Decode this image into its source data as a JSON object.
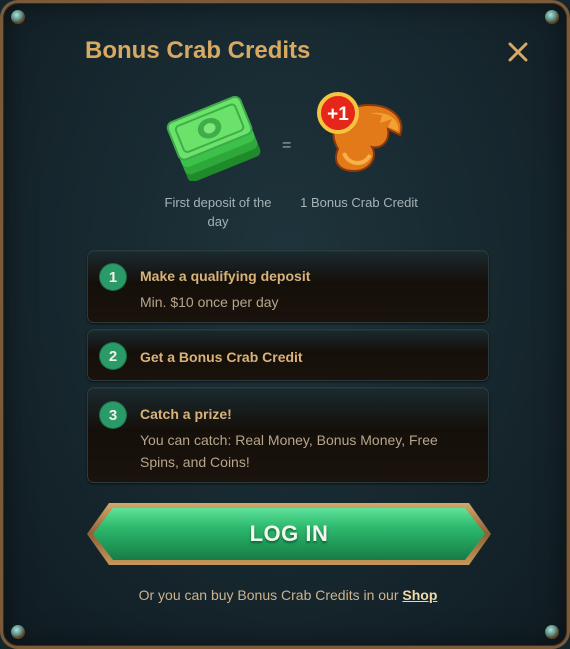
{
  "modal": {
    "title": "Bonus Crab Credits",
    "close_icon": "close-icon",
    "colors": {
      "title": "#d7a963",
      "accent_green": "#2fbb6f",
      "step_number_bg": "#2a9a68",
      "frame_gold": "#b58a52"
    }
  },
  "exchange": {
    "left_caption": "First deposit of the day",
    "equals": "=",
    "right_caption": "1 Bonus Crab Credit",
    "badge": "+1",
    "left_icon": "money-stack-icon",
    "right_icon": "crab-claw-icon"
  },
  "steps": [
    {
      "number": "1",
      "title": "Make a qualifying deposit",
      "description": "Min. $10 once per day"
    },
    {
      "number": "2",
      "title": "Get a Bonus Crab Credit",
      "description": ""
    },
    {
      "number": "3",
      "title": "Catch a prize!",
      "description": "You can catch: Real Money, Bonus Money, Free Spins, and Coins!"
    }
  ],
  "login_button": {
    "label": "LOG IN"
  },
  "footer": {
    "text": "Or you can buy Bonus Crab Credits in our ",
    "link": "Shop"
  }
}
